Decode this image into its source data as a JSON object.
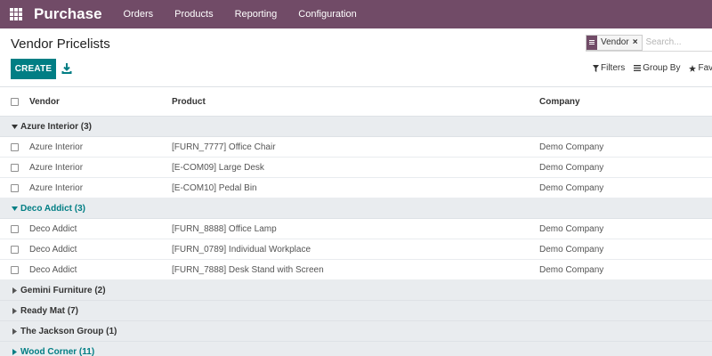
{
  "navbar": {
    "brand": "Purchase",
    "menu": [
      "Orders",
      "Products",
      "Reporting",
      "Configuration"
    ],
    "color": "#714B67"
  },
  "page": {
    "title": "Vendor Pricelists",
    "create_label": "CREATE",
    "download_icon": "download-icon"
  },
  "search": {
    "facet_value": "Vendor",
    "facet_remove": "×",
    "placeholder": "Search..."
  },
  "filters": {
    "filters_label": "Filters",
    "groupby_label": "Group By",
    "favorites_label": "Favorites"
  },
  "table": {
    "headers": {
      "vendor": "Vendor",
      "product": "Product",
      "company": "Company"
    },
    "groups": [
      {
        "label": "Azure Interior (3)",
        "open": true,
        "rows": [
          {
            "vendor": "Azure Interior",
            "product": "[FURN_7777] Office Chair",
            "company": "Demo Company"
          },
          {
            "vendor": "Azure Interior",
            "product": "[E-COM09] Large Desk",
            "company": "Demo Company"
          },
          {
            "vendor": "Azure Interior",
            "product": "[E-COM10] Pedal Bin",
            "company": "Demo Company"
          }
        ]
      },
      {
        "label": "Deco Addict (3)",
        "open": true,
        "rows": [
          {
            "vendor": "Deco Addict",
            "product": "[FURN_8888] Office Lamp",
            "company": "Demo Company"
          },
          {
            "vendor": "Deco Addict",
            "product": "[FURN_0789] Individual Workplace",
            "company": "Demo Company"
          },
          {
            "vendor": "Deco Addict",
            "product": "[FURN_7888] Desk Stand with Screen",
            "company": "Demo Company"
          }
        ]
      },
      {
        "label": "Gemini Furniture (2)",
        "open": false,
        "rows": []
      },
      {
        "label": "Ready Mat (7)",
        "open": false,
        "rows": []
      },
      {
        "label": "The Jackson Group (1)",
        "open": false,
        "rows": []
      },
      {
        "label": "Wood Corner (11)",
        "open": false,
        "rows": []
      }
    ]
  },
  "colors": {
    "accent": "#017E84",
    "navbar": "#714B67"
  }
}
